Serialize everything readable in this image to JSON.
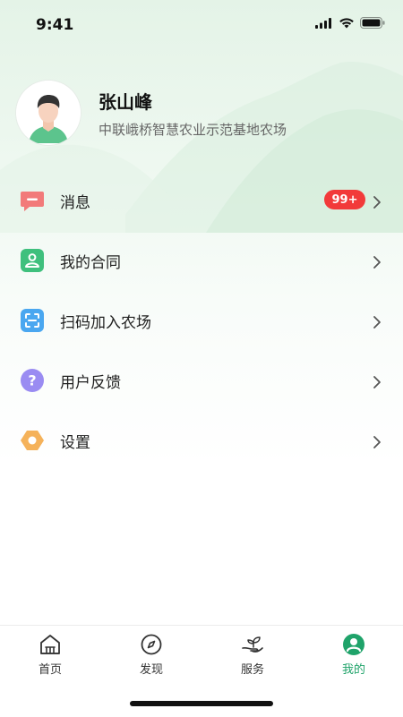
{
  "status_bar": {
    "time": "9:41"
  },
  "profile": {
    "name": "张山峰",
    "org": "中联峨桥智慧农业示范基地农场"
  },
  "menu": [
    {
      "label": "消息",
      "icon": "message-icon",
      "badge": "99+",
      "color": "#f27a7a"
    },
    {
      "label": "我的合同",
      "icon": "contract-icon",
      "color": "#3fc07d"
    },
    {
      "label": "扫码加入农场",
      "icon": "scan-icon",
      "color": "#4aa7f0"
    },
    {
      "label": "用户反馈",
      "icon": "feedback-icon",
      "color": "#9a8cf2"
    },
    {
      "label": "设置",
      "icon": "settings-icon",
      "color": "#f5b25a"
    }
  ],
  "tabs": [
    {
      "label": "首页",
      "icon": "home-icon",
      "active": false
    },
    {
      "label": "发现",
      "icon": "compass-icon",
      "active": false
    },
    {
      "label": "服务",
      "icon": "sprout-hand-icon",
      "active": false
    },
    {
      "label": "我的",
      "icon": "user-icon",
      "active": true
    }
  ],
  "colors": {
    "accent": "#1fa36a",
    "badge": "#f23a3a"
  }
}
